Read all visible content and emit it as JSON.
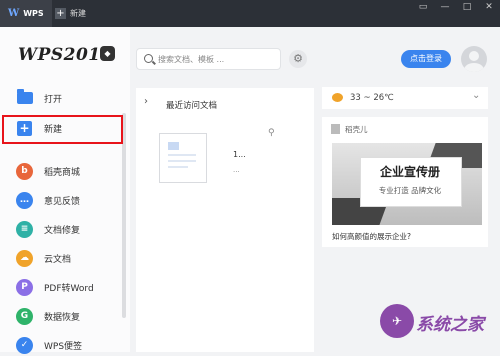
{
  "titlebar": {
    "app_tab_label": "WPS",
    "new_tab_label": "新建",
    "controls": [
      "▭",
      "—",
      "□",
      "✕"
    ]
  },
  "brand": {
    "logo_text": "WPS2019"
  },
  "sidebar": {
    "open_label": "打开",
    "new_label": "新建",
    "items": [
      {
        "label": "稻壳商城",
        "icon": "shop-icon",
        "color": "#e8663b"
      },
      {
        "label": "意见反馈",
        "icon": "feedback-icon",
        "color": "#3a84ee"
      },
      {
        "label": "文档修复",
        "icon": "repair-icon",
        "color": "#2fb1a6"
      },
      {
        "label": "云文档",
        "icon": "cloud-icon",
        "color": "#f0a32a"
      },
      {
        "label": "PDF转Word",
        "icon": "pdf-convert-icon",
        "color": "#8b6fe6"
      },
      {
        "label": "数据恢复",
        "icon": "recover-icon",
        "color": "#2fb36a"
      },
      {
        "label": "WPS便签",
        "icon": "note-icon",
        "color": "#3a84ee"
      }
    ]
  },
  "search": {
    "placeholder": "搜索文档、模板 ..."
  },
  "header": {
    "login_label": "点击登录"
  },
  "recent": {
    "title": "最近访问文档",
    "doc_title": "1...",
    "doc_sub": "..."
  },
  "weather": {
    "text": "33 ~ 26℃"
  },
  "news": {
    "source": "稻壳儿",
    "banner_title": "企业宣传册",
    "banner_sub": "专业打造 品牌文化",
    "caption": "如何高颜值的展示企业?"
  },
  "watermark": {
    "text": "系统之家"
  },
  "colors": {
    "accent": "#3a84ee",
    "highlight": "#e8141b",
    "titlebar": "#2c3037"
  }
}
